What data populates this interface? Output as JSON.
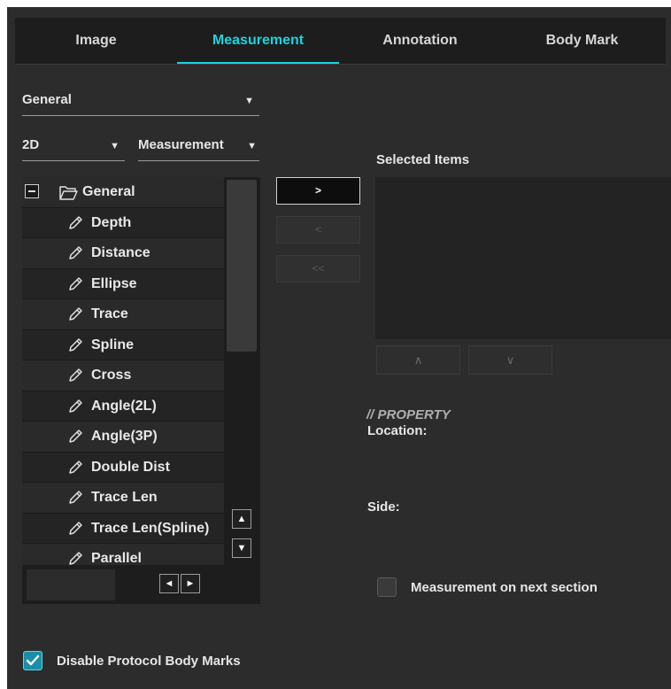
{
  "tabs": [
    {
      "label": "Image"
    },
    {
      "label": "Measurement"
    },
    {
      "label": "Annotation"
    },
    {
      "label": "Body Mark"
    }
  ],
  "active_tab": "Measurement",
  "dropdowns": {
    "group": "General",
    "mode": "2D",
    "category": "Measurement"
  },
  "tree": {
    "root": "General",
    "items": [
      "Depth",
      "Distance",
      "Ellipse",
      "Trace",
      "Spline",
      "Cross",
      "Angle(2L)",
      "Angle(3P)",
      "Double Dist",
      "Trace Len",
      "Trace Len(Spline)",
      "Parallel"
    ]
  },
  "transfer": {
    "add": ">",
    "remove": "<",
    "remove_all": "<<"
  },
  "selected_items_label": "Selected Items",
  "move": {
    "up": "∧",
    "down": "∨"
  },
  "property": {
    "header": "// PROPERTY",
    "location_label": "Location:",
    "side_label": "Side:"
  },
  "next_section": {
    "label": "Measurement on next section",
    "checked": false
  },
  "disable_body_marks": {
    "label": "Disable Protocol Body Marks",
    "checked": true
  },
  "scroll": {
    "up": "▲",
    "down": "▼",
    "left": "◄",
    "right": "►"
  },
  "colors": {
    "accent": "#19d3e0",
    "panel": "#2c2c2c",
    "check": "#1a8ea8"
  },
  "icons": {
    "folder": "folder-open-icon",
    "item": "ruler-pencil-icon"
  }
}
